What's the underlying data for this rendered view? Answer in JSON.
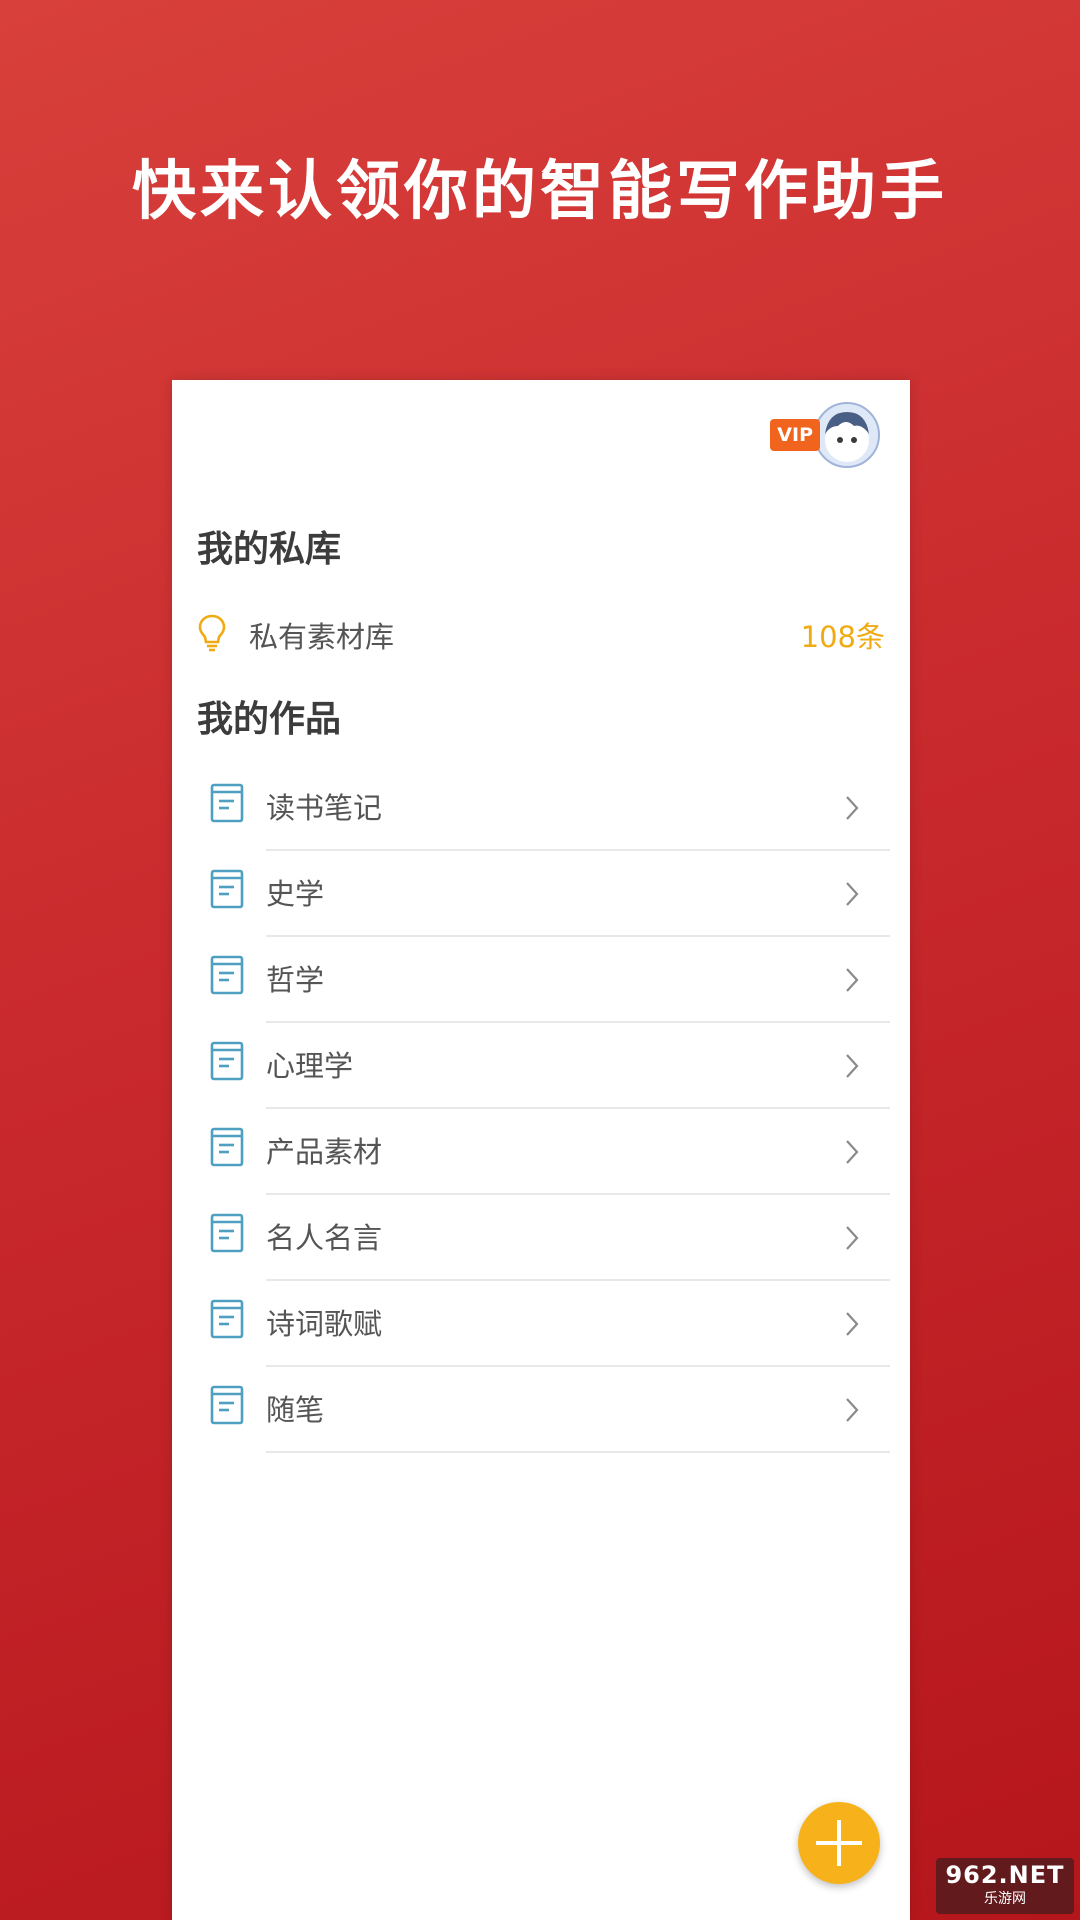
{
  "headline": "快来认领你的智能写作助手",
  "header": {
    "vip_badge": "VIP",
    "avatar_icon": "avatar-icon"
  },
  "private_library": {
    "title": "我的私库",
    "item_label": "私有素材库",
    "item_count": "108条",
    "icon": "lightbulb-icon"
  },
  "works": {
    "title": "我的作品",
    "items": [
      {
        "label": "读书笔记"
      },
      {
        "label": "史学"
      },
      {
        "label": "哲学"
      },
      {
        "label": "心理学"
      },
      {
        "label": "产品素材"
      },
      {
        "label": "名人名言"
      },
      {
        "label": "诗词歌赋"
      },
      {
        "label": "随笔"
      }
    ]
  },
  "fab": {
    "icon": "plus-icon"
  },
  "watermark": {
    "top": "962.NET",
    "bottom": "乐游网"
  },
  "colors": {
    "background_top": "#d8403b",
    "background_bottom": "#b5161c",
    "count_accent": "#f0aa12",
    "fab": "#f7b21b",
    "vip": "#f0641e",
    "doc_icon": "#4e9fc0"
  }
}
